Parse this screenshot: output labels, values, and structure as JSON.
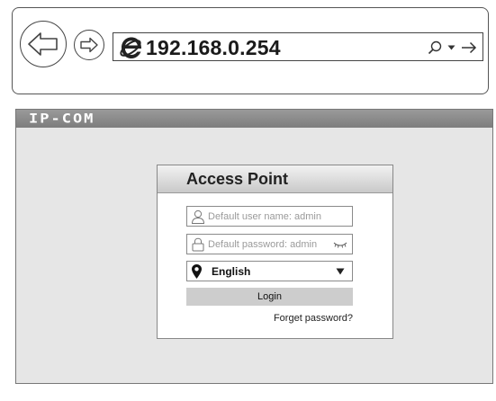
{
  "browser": {
    "url": "192.168.0.254",
    "icons": [
      "back-arrow-icon",
      "forward-arrow-icon",
      "internet-explorer-icon",
      "search-icon",
      "dropdown-arrow-icon",
      "go-arrow-icon"
    ]
  },
  "brand": {
    "logo_text": "IP-COM",
    "bar_color": "#8a8a8a"
  },
  "login": {
    "title": "Access Point",
    "username_placeholder": "Default user name: admin",
    "username_value": "",
    "password_placeholder": "Default password: admin",
    "password_value": "",
    "language": "English",
    "login_label": "Login",
    "forget_label": "Forget password?"
  }
}
